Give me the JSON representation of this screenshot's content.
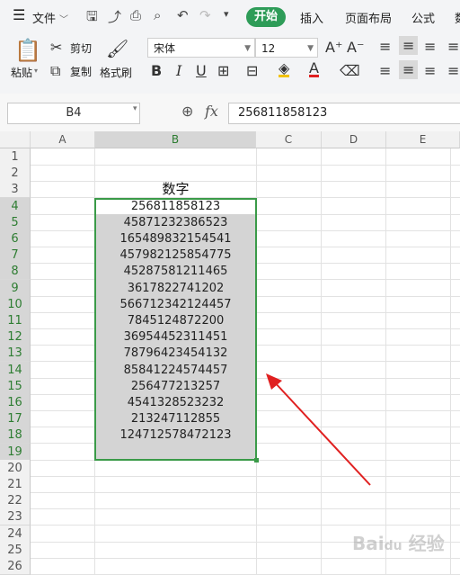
{
  "menubar": {
    "file_label": "文件",
    "tabs": [
      "开始",
      "插入",
      "页面布局",
      "公式",
      "数"
    ]
  },
  "ribbon": {
    "paste_label": "粘贴",
    "cut_label": "剪切",
    "copy_label": "复制",
    "format_painter_label": "格式刷",
    "font_name": "宋体",
    "font_size": "12"
  },
  "formula_bar": {
    "name_box": "B4",
    "fx_symbol": "fx",
    "value": "256811858123"
  },
  "sheet": {
    "columns": [
      "A",
      "B",
      "C",
      "D",
      "E"
    ],
    "rows": [
      "1",
      "2",
      "3",
      "4",
      "5",
      "6",
      "7",
      "8",
      "9",
      "10",
      "11",
      "12",
      "13",
      "14",
      "15",
      "16",
      "17",
      "18",
      "19",
      "20",
      "21",
      "22",
      "23",
      "24",
      "25",
      "26"
    ],
    "header_cell": "数字",
    "values": [
      "256811858123",
      "45871232386523",
      "165489832154541",
      "457982125854775",
      "45287581211465",
      "3617822741202",
      "566712342124457",
      "7845124872200",
      "36954452311451",
      "78796423454132",
      "85841224574457",
      "256477213257",
      "4541328523232",
      "213247112855",
      "124712578472123",
      ""
    ]
  },
  "colors": {
    "accent": "#2e9c58",
    "selection": "#3a9a48",
    "arrow": "#e02020"
  }
}
